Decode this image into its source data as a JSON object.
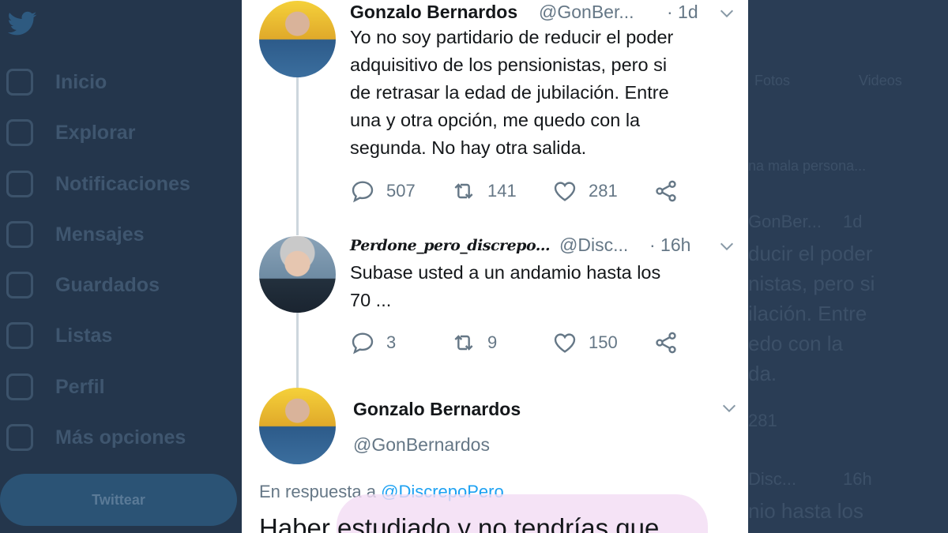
{
  "background": {
    "nav": [
      "Inicio",
      "Explorar",
      "Notificaciones",
      "Mensajes",
      "Guardados",
      "Listas",
      "Perfil",
      "Más opciones"
    ],
    "tweet_button": "Twittear",
    "right_tabs": [
      "Fotos",
      "Videos"
    ],
    "right_fragments": [
      "na mala persona...",
      "GonBer...",
      "1d",
      "ducir el poder",
      "nistas, pero si",
      "ilación. Entre",
      "edo con la",
      "da.",
      "281",
      "Disc...",
      "16h",
      "nio hasta los"
    ]
  },
  "tweets": [
    {
      "name": "Gonzalo Bernardos",
      "handle": "@GonBer...",
      "time": "· 1d",
      "text_lines": [
        "Yo no soy partidario de reducir el poder",
        "adquisitivo de los pensionistas, pero si",
        "de retrasar la edad de jubilación. Entre",
        "una y otra opción, me quedo con la",
        "segunda. No hay otra salida."
      ],
      "replies": "507",
      "retweets": "141",
      "likes": "281"
    },
    {
      "name": "Perdone_pero_discrepo...",
      "handle": "@Disc...",
      "time": "· 16h",
      "text_lines": [
        "Subase usted a un andamio hasta los",
        "70 ..."
      ],
      "replies": "3",
      "retweets": "9",
      "likes": "150"
    }
  ],
  "main_tweet": {
    "name": "Gonzalo Bernardos",
    "handle": "@GonBernardos",
    "reply_prefix": "En respuesta a",
    "reply_mention": "@DiscrepoPero",
    "text": "Haber estudiado y no tendrías que"
  },
  "colors": {
    "accent": "#1da1f2",
    "text": "#14171a",
    "muted": "#657786"
  }
}
